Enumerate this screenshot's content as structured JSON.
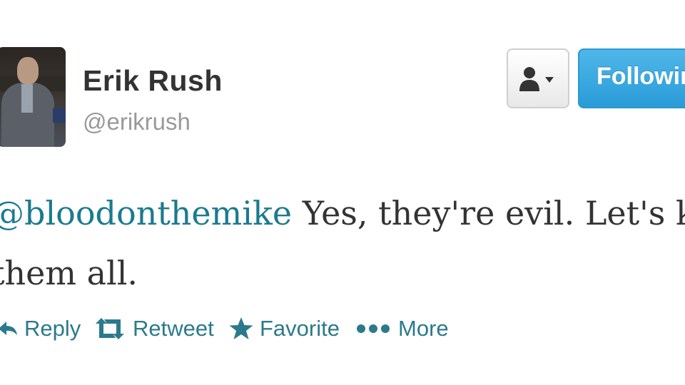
{
  "user": {
    "name": "Erik Rush",
    "handle": "@erikrush"
  },
  "buttons": {
    "user_menu_icon": "person-dropdown-icon",
    "follow_label": "Following"
  },
  "tweet": {
    "mention": "@bloodonthemike",
    "text_line1": " Yes, they're evil. Let's kill",
    "text_line2": "them all."
  },
  "actions": [
    {
      "label": "Reply",
      "icon": "reply-icon"
    },
    {
      "label": "Retweet",
      "icon": "retweet-icon"
    },
    {
      "label": "Favorite",
      "icon": "star-icon"
    },
    {
      "label": "More",
      "icon": "more-dots-icon"
    }
  ],
  "colors": {
    "link": "#1b7a8e",
    "action": "#2b7a8c",
    "follow_bg": "#2a9bd8",
    "name": "#333333",
    "handle": "#999999"
  }
}
